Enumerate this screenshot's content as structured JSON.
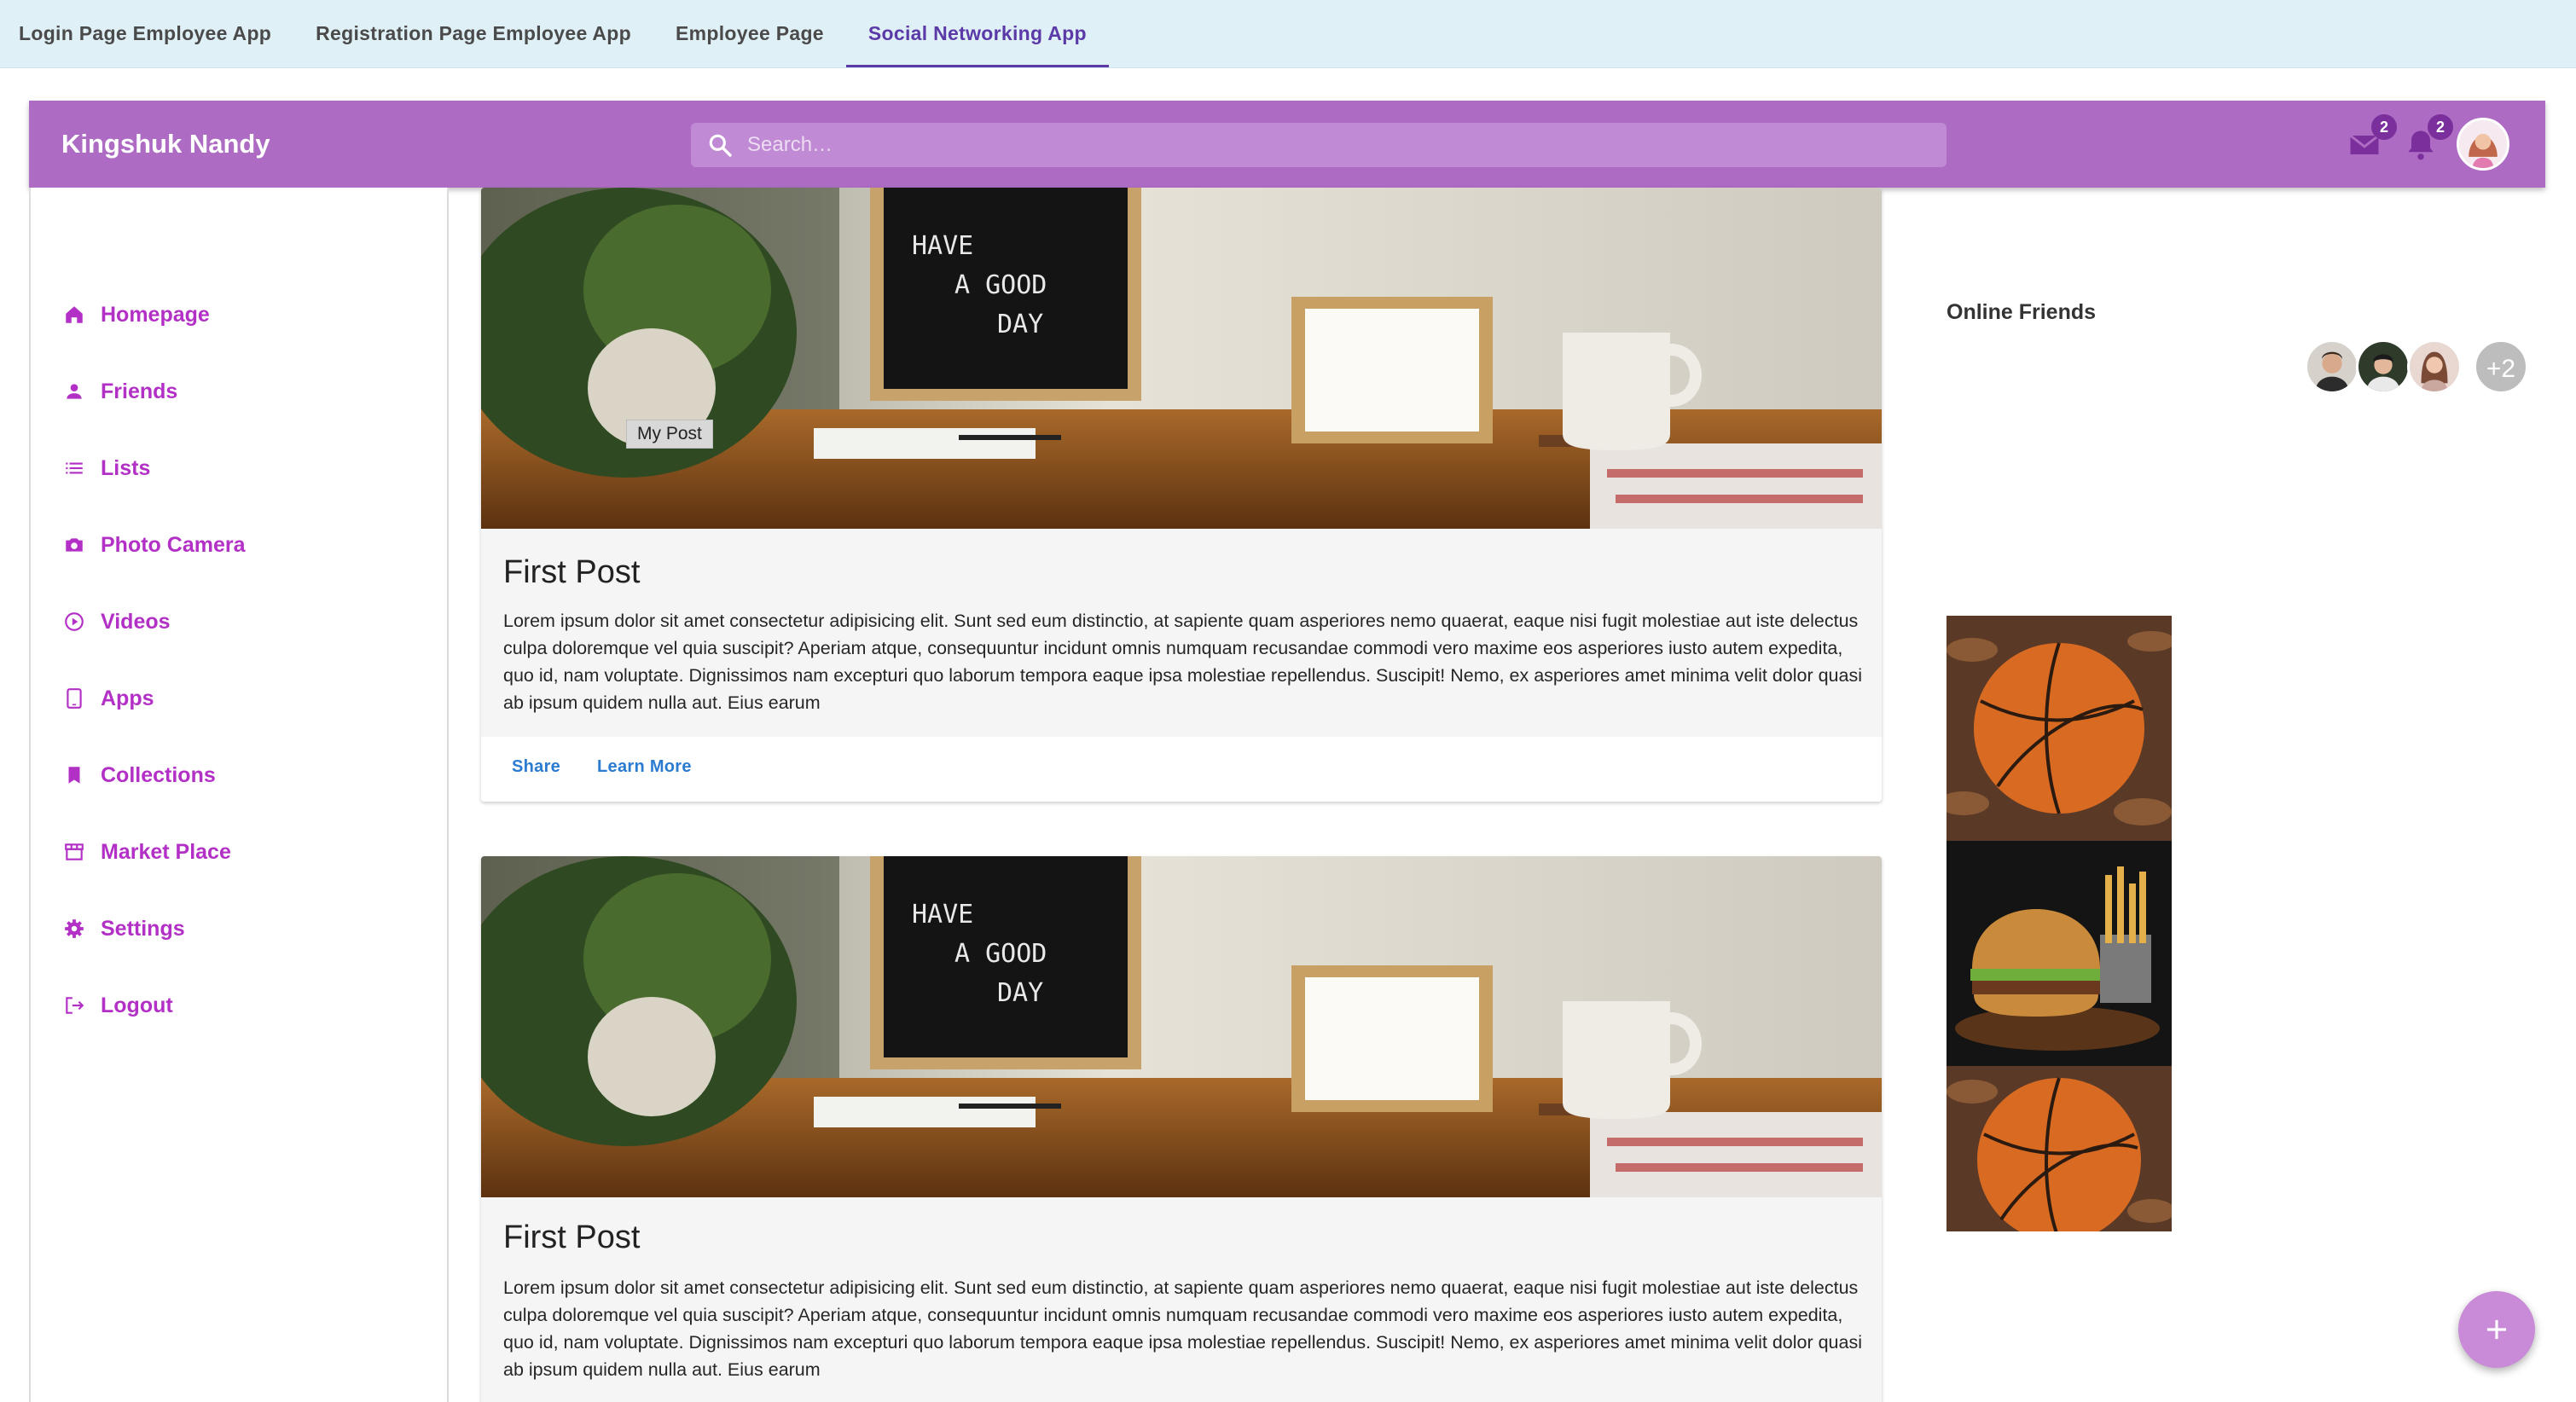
{
  "tabs": [
    {
      "label": "Login Page Employee App"
    },
    {
      "label": "Registration Page Employee App"
    },
    {
      "label": "Employee Page"
    },
    {
      "label": "Social Networking App"
    }
  ],
  "active_tab_index": 3,
  "appbar": {
    "brand": "Kingshuk Nandy",
    "search_placeholder": "Search…",
    "mail_count": "2",
    "notifications_count": "2",
    "color": "#ad6bc4"
  },
  "sidebar": {
    "items": [
      {
        "label": "Homepage",
        "icon": "home-icon"
      },
      {
        "label": "Friends",
        "icon": "person-icon"
      },
      {
        "label": "Lists",
        "icon": "list-icon"
      },
      {
        "label": "Photo Camera",
        "icon": "camera-icon"
      },
      {
        "label": "Videos",
        "icon": "play-circle-icon"
      },
      {
        "label": "Apps",
        "icon": "tablet-icon"
      },
      {
        "label": "Collections",
        "icon": "bookmark-icon"
      },
      {
        "label": "Market Place",
        "icon": "storefront-icon"
      },
      {
        "label": "Settings",
        "icon": "gear-icon"
      },
      {
        "label": "Logout",
        "icon": "logout-icon"
      }
    ],
    "accent": "#b330c6"
  },
  "posts": [
    {
      "title": "First Post",
      "body": "Lorem ipsum dolor sit amet consectetur adipisicing elit. Sunt sed eum distinctio, at sapiente quam asperiores nemo quaerat, eaque nisi fugit molestiae aut iste delectus culpa doloremque vel quia suscipit? Aperiam atque, consequuntur incidunt omnis numquam recusandae commodi vero maxime eos asperiores iusto autem expedita, quo id, nam voluptate. Dignissimos nam excepturi quo laborum tempora eaque ipsa molestiae repellendus. Suscipit! Nemo, ex asperiores amet minima velit dolor quasi ab ipsum quidem nulla aut. Eius earum",
      "tooltip": "My Post",
      "share_label": "Share",
      "learn_more_label": "Learn More",
      "sign_text": [
        "HAVE",
        "A GOOD",
        "DAY"
      ]
    },
    {
      "title": "First Post",
      "body": "Lorem ipsum dolor sit amet consectetur adipisicing elit. Sunt sed eum distinctio, at sapiente quam asperiores nemo quaerat, eaque nisi fugit molestiae aut iste delectus culpa doloremque vel quia suscipit? Aperiam atque, consequuntur incidunt omnis numquam recusandae commodi vero maxime eos asperiores iusto autem expedita, quo id, nam voluptate. Dignissimos nam excepturi quo laborum tempora eaque ipsa molestiae repellendus. Suscipit! Nemo, ex asperiores amet minima velit dolor quasi ab ipsum quidem nulla aut. Eius earum",
      "sign_text": [
        "HAVE",
        "A GOOD",
        "DAY"
      ]
    }
  ],
  "right_panel": {
    "online_title": "Online Friends",
    "more_count": "+2",
    "gallery": [
      "basketball",
      "burger-and-fries",
      "basketball"
    ]
  }
}
